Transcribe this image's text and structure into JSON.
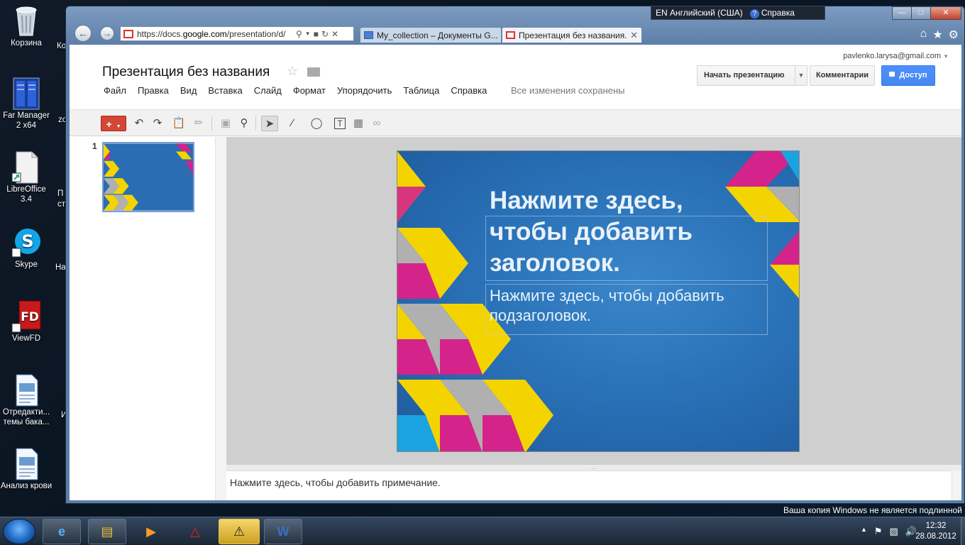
{
  "desktop": {
    "icons": [
      {
        "label": "Корзина",
        "icon": "recycle-bin-icon"
      },
      {
        "label": "Far Manager 2 x64",
        "icon": "far-manager-icon"
      },
      {
        "label": "LibreOffice 3.4",
        "icon": "libreoffice-icon"
      },
      {
        "label": "Skype",
        "icon": "skype-icon"
      },
      {
        "label": "ViewFD",
        "icon": "viewfd-icon"
      },
      {
        "label": "Отредакти... темы бака...",
        "icon": "document-icon"
      },
      {
        "label": "Анализ крови",
        "icon": "document-icon"
      }
    ],
    "cut_labels": [
      "Ко",
      "zo",
      "П",
      "ст",
      "На",
      "И"
    ],
    "watermark": "Ваша копия Windows не является подлинной"
  },
  "language_bar": {
    "lang": "EN Английский (США)",
    "help": "Справка"
  },
  "browser": {
    "url_prefix": "https://docs.",
    "url_domain": "google.com",
    "url_suffix": "/presentation/d/",
    "tabs": [
      {
        "title": "My_collection – Документы G...",
        "active": false
      },
      {
        "title": "Презентация без названия...",
        "active": true
      }
    ]
  },
  "app": {
    "doc_title": "Презентация без названия",
    "account": "pavlenko.larysa@gmail.com",
    "menu": [
      "Файл",
      "Правка",
      "Вид",
      "Вставка",
      "Слайд",
      "Формат",
      "Упорядочить",
      "Таблица",
      "Справка"
    ],
    "saved_status": "Все изменения сохранены",
    "buttons": {
      "present": "Начать презентацию",
      "comments": "Комментарии",
      "share": "Доступ"
    },
    "slide_number": "1",
    "slide": {
      "title_placeholder": "Нажмите здесь, чтобы добавить заголовок.",
      "subtitle_placeholder": "Нажмите здесь, чтобы добавить подзаголовок."
    },
    "notes_placeholder": "Нажмите здесь, чтобы добавить примечание."
  },
  "taskbar": {
    "time": "12:32",
    "date": "28.08.2012"
  },
  "colors": {
    "accent_red": "#d14836",
    "share_blue": "#4d90fe",
    "slide_blue": "#2a72b8",
    "magenta": "#d4238a",
    "yellow": "#f4d400",
    "cyan": "#1aa3e0",
    "gray": "#b0b0b0"
  }
}
